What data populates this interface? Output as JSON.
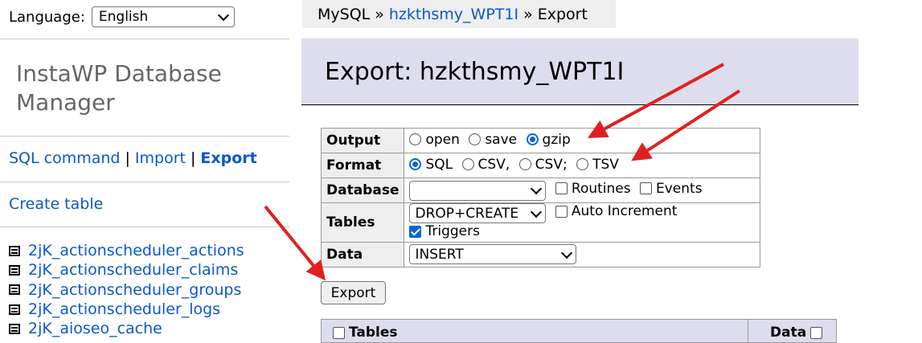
{
  "sidebar": {
    "language_label": "Language:",
    "language_value": "English",
    "brand": "InstaWP Database Manager",
    "nav": {
      "sql_command": "SQL command",
      "separator": "|",
      "import": "Import",
      "export": "Export"
    },
    "create_table": "Create table",
    "tables": [
      "2jK_actionscheduler_actions",
      "2jK_actionscheduler_claims",
      "2jK_actionscheduler_groups",
      "2jK_actionscheduler_logs",
      "2jK_aioseo_cache"
    ]
  },
  "breadcrumb": {
    "root": "MySQL",
    "separator": "»",
    "db": "hzkthsmy_WPT1I",
    "current": "Export"
  },
  "header": {
    "title": "Export: hzkthsmy_WPT1I"
  },
  "form": {
    "output": {
      "label": "Output",
      "options": [
        "open",
        "save",
        "gzip"
      ],
      "selected": "gzip"
    },
    "format": {
      "label": "Format",
      "options": [
        "SQL",
        "CSV,",
        "CSV;",
        "TSV"
      ],
      "selected": "SQL"
    },
    "database": {
      "label": "Database",
      "select_value": "",
      "routines": "Routines",
      "events": "Events"
    },
    "tables": {
      "label": "Tables",
      "select_value": "DROP+CREATE",
      "auto_increment": "Auto Increment",
      "triggers": "Triggers"
    },
    "data": {
      "label": "Data",
      "select_value": "INSERT"
    }
  },
  "export_button": "Export",
  "table_header": {
    "tables": "Tables",
    "data": "Data"
  },
  "colors": {
    "link": "#0a58ca",
    "header_bg": "#ddddee",
    "arrow": "#e02020",
    "accent": "#0b66d6"
  }
}
